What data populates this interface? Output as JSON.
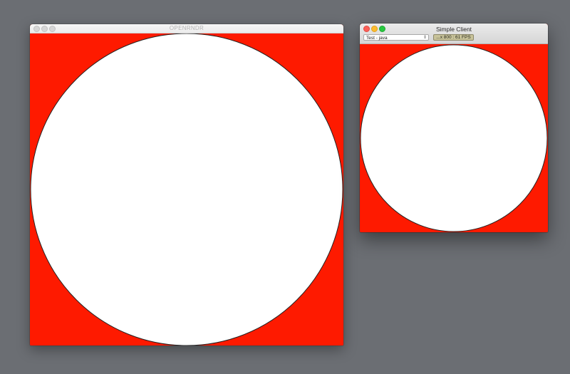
{
  "desktop": {
    "background": "#6b6e73"
  },
  "openrndr_window": {
    "title": "OPENRNDR",
    "state": "inactive",
    "canvas": {
      "background": "#fe1a00",
      "shape": "circle",
      "fill": "#ffffff",
      "stroke": "#222222"
    },
    "traffic_lights": [
      "close-icon",
      "minimize-icon",
      "zoom-icon"
    ]
  },
  "client_window": {
    "title": "Simple Client",
    "state": "active",
    "selector": {
      "value": "Test - java",
      "icon": "updown-chevron-icon"
    },
    "fps_readout": "...x 800 : 61 FPS",
    "canvas": {
      "background": "#fe1a00",
      "shape": "circle",
      "fill": "#ffffff",
      "stroke": "#222222"
    },
    "traffic_lights": [
      "close-icon",
      "minimize-icon",
      "zoom-icon"
    ],
    "colors": {
      "close": "#fc5f57",
      "minimize": "#fdbc2e",
      "zoom": "#28c940",
      "fps_badge": "#c8c39a"
    }
  }
}
